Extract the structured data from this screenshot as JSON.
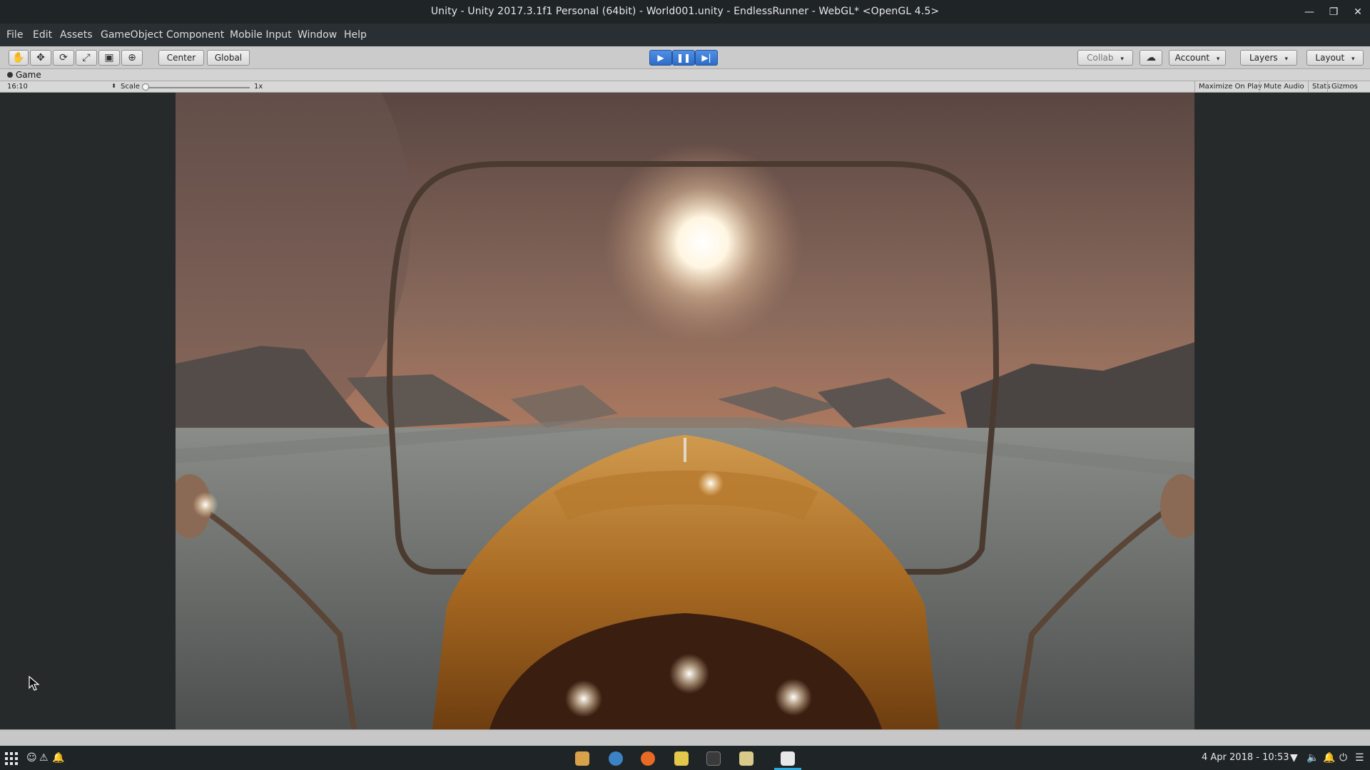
{
  "window": {
    "title": "Unity - Unity 2017.3.1f1 Personal (64bit) - World001.unity - EndlessRunner - WebGL* <OpenGL 4.5>",
    "minimize_icon": "minimize-icon",
    "maximize_icon": "maximize-icon",
    "close_icon": "close-icon",
    "minimize_symbol": "—",
    "maximize_symbol": "❐",
    "close_symbol": "✕"
  },
  "menu": {
    "file": "File",
    "edit": "Edit",
    "assets": "Assets",
    "gameobject": "GameObject",
    "component": "Component",
    "mobile_input": "Mobile Input",
    "window": "Window",
    "help": "Help"
  },
  "toolbar": {
    "hand_icon": "hand-icon",
    "move_icon": "move-icon",
    "rotate_icon": "rotate-icon",
    "scale_icon": "scale-icon",
    "rect_icon": "rect-tool-icon",
    "transform_icon": "transform-icon",
    "hand_glyph": "✋",
    "move_glyph": "✥",
    "rotate_glyph": "⟳",
    "scale_glyph": "⤢",
    "rect_glyph": "▣",
    "transform_glyph": "⊕",
    "center_label": "Center",
    "global_label": "Global",
    "play_glyph": "▶",
    "pause_glyph": "❚❚",
    "step_glyph": "▶|",
    "collab_label": "Collab",
    "cloud_glyph": "☁",
    "account_label": "Account",
    "layers_label": "Layers",
    "layout_label": "Layout",
    "dropdown_glyph": "▾"
  },
  "game_tab": {
    "label": "Game",
    "aspect": "16:10",
    "scale_label": "Scale",
    "scale_value": "1x",
    "maximize_on_play": "Maximize On Play",
    "mute_audio": "Mute Audio",
    "stats": "Stats",
    "gizmos": "Gizmos"
  },
  "taskbar": {
    "clock": "4 Apr 2018 - 10:53",
    "tray": [
      "☺",
      "⚠",
      "🔔"
    ],
    "right_tray": [
      "▼",
      "🔈",
      "🔔",
      "⏻",
      "☰"
    ]
  },
  "colors": {
    "play_active": "#2f6cc7",
    "titlebar": "#1f2427",
    "toolbar": "#cbcbcb",
    "accent": "#2ea7d9"
  }
}
